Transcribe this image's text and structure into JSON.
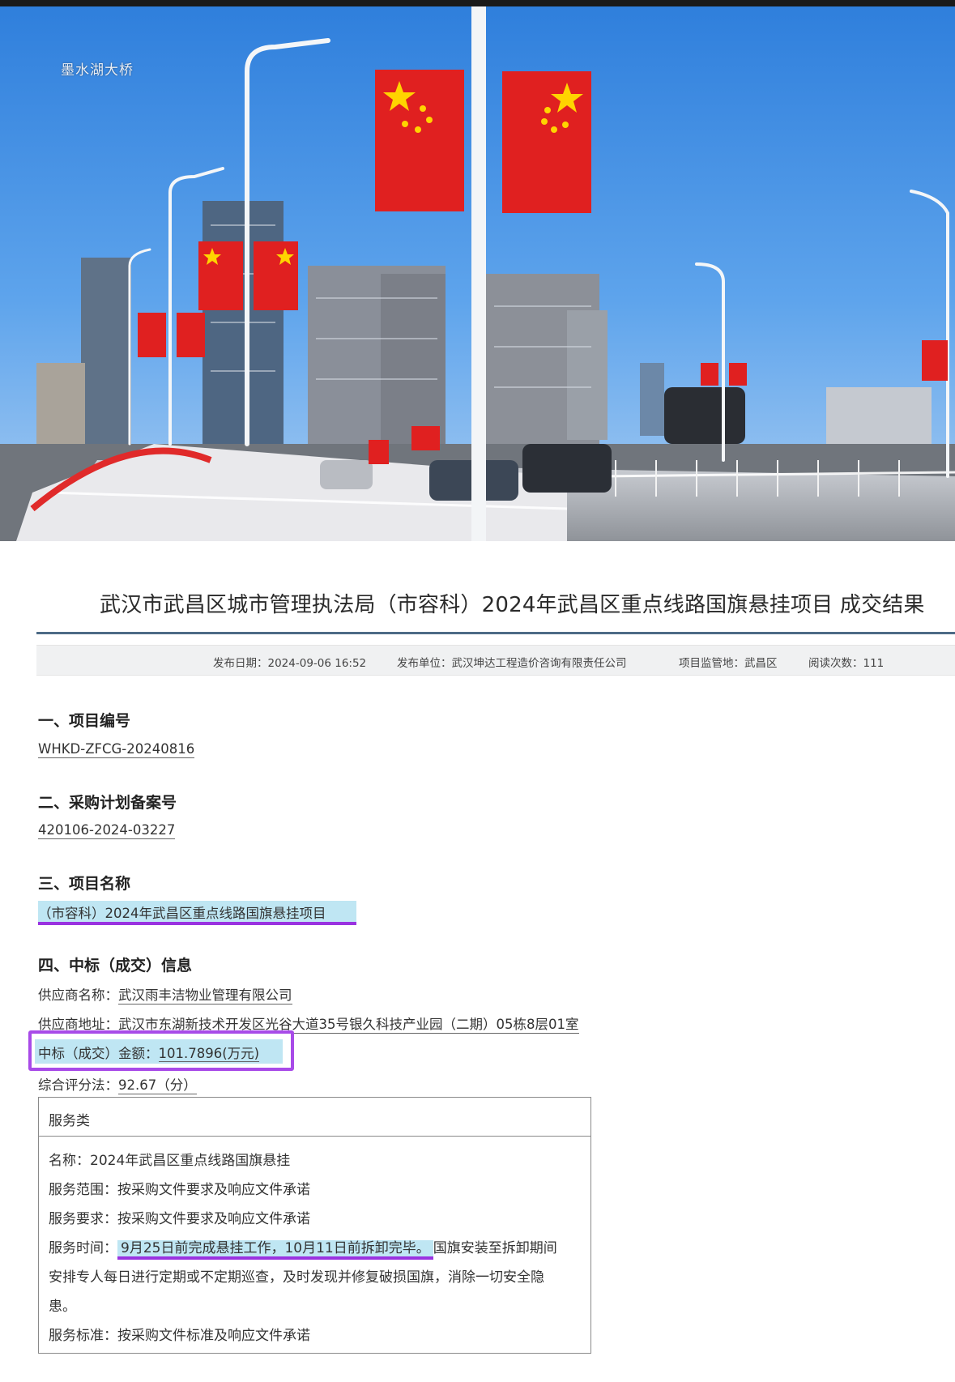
{
  "photo": {
    "watermark": "墨水湖大桥",
    "colors": {
      "sky": "#3f8ce0",
      "flag": "#e02020",
      "star": "#ffd400",
      "bridge": "#e8e8ea"
    }
  },
  "document": {
    "title": "武汉市武昌区城市管理执法局（市容科）2024年武昌区重点线路国旗悬挂项目 成交结果",
    "meta": {
      "publish_date": "发布日期：2024-09-06 16:52",
      "publisher": "发布单位：武汉坤达工程造价咨询有限责任公司",
      "supervision_place": "项目监管地：武昌区",
      "read_count": "阅读次数：111"
    },
    "sections": [
      {
        "heading": "一、项目编号",
        "value": "WHKD-ZFCG-20240816"
      },
      {
        "heading": "二、采购计划备案号",
        "value": "420106-2024-03227"
      },
      {
        "heading": "三、项目名称",
        "value": "（市容科）2024年武昌区重点线路国旗悬挂项目"
      },
      {
        "heading": "四、中标（成交）信息"
      }
    ],
    "bid_info": {
      "supplier_name_label": "供应商名称：",
      "supplier_name": "武汉雨丰洁物业管理有限公司",
      "supplier_address_label": "供应商地址：",
      "supplier_address": "武汉市东湖新技术开发区光谷大道35号银久科技产业园（二期）05栋8层01室",
      "amount_label": "中标（成交）金额：",
      "amount": "101.7896(万元)",
      "score_label": "综合评分法：",
      "score": "92.67（分）"
    },
    "service_table": {
      "header": "服务类",
      "name": "名称：2024年武昌区重点线路国旗悬挂",
      "scope": "服务范围：按采购文件要求及响应文件承诺",
      "requirement": "服务要求：按采购文件要求及响应文件承诺",
      "time_label": "服务时间：",
      "time_highlight": "9月25日前完成悬挂工作，10月11日前拆卸完毕。",
      "time_rest_1": "国旗安装至拆卸期间",
      "time_rest_2": "安排专人每日进行定期或不定期巡查，及时发现并修复破损国旗，消除一切安全隐",
      "time_rest_3": "患。",
      "standard": "服务标准：按采购文件标准及响应文件承诺"
    }
  }
}
